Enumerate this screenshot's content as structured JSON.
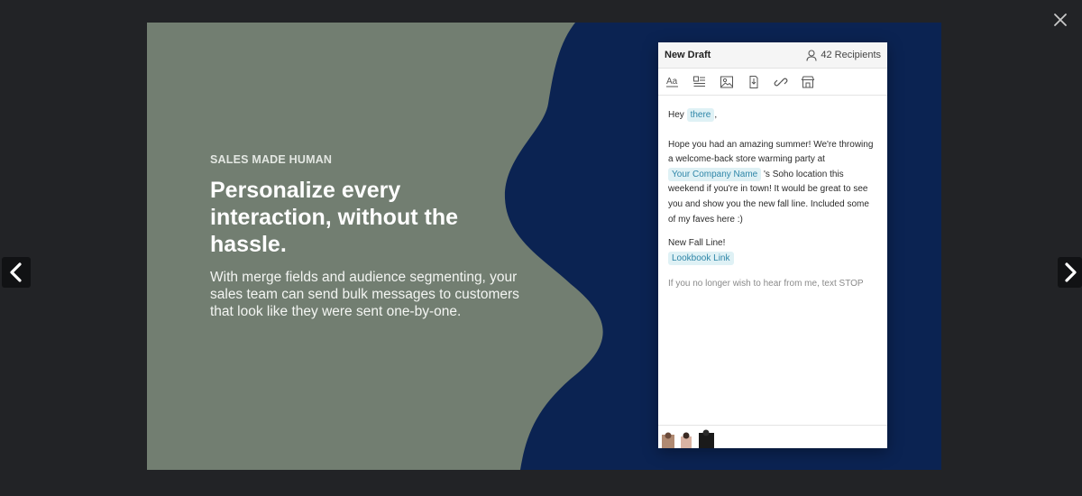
{
  "viewer": {
    "close_icon": "close-icon",
    "prev_icon": "chevron-left-icon",
    "next_icon": "chevron-right-icon"
  },
  "slide": {
    "kicker": "SALES MADE HUMAN",
    "headline": "Personalize every interaction, without the hassle.",
    "body": "With merge fields and audience segmenting, your sales team can send bulk messages to customers that look like they were sent one-by-one.",
    "colors": {
      "panel": "#727e71",
      "wave": "#0b2352"
    }
  },
  "draft": {
    "title": "New Draft",
    "recipients": "42 Recipients",
    "toolbar_icons": [
      "text-format-icon",
      "template-icon",
      "image-icon",
      "attachment-icon",
      "link-icon",
      "store-icon"
    ],
    "greeting": "Hey",
    "merge_first_name": "there",
    "greeting_punct": ",",
    "para1_start": "Hope you had an amazing summer! We're throwing a welcome-back store warming party at",
    "merge_company": "Your Company Name",
    "para1_end": "'s Soho location this weekend if you're in town! It would be great to see you and show you the new fall line. Included some of my faves here :)",
    "new_line_label": "New Fall Line!",
    "lookbook_link": "Lookbook Link",
    "opt_out": "If you no longer wish to hear from me, text STOP"
  }
}
